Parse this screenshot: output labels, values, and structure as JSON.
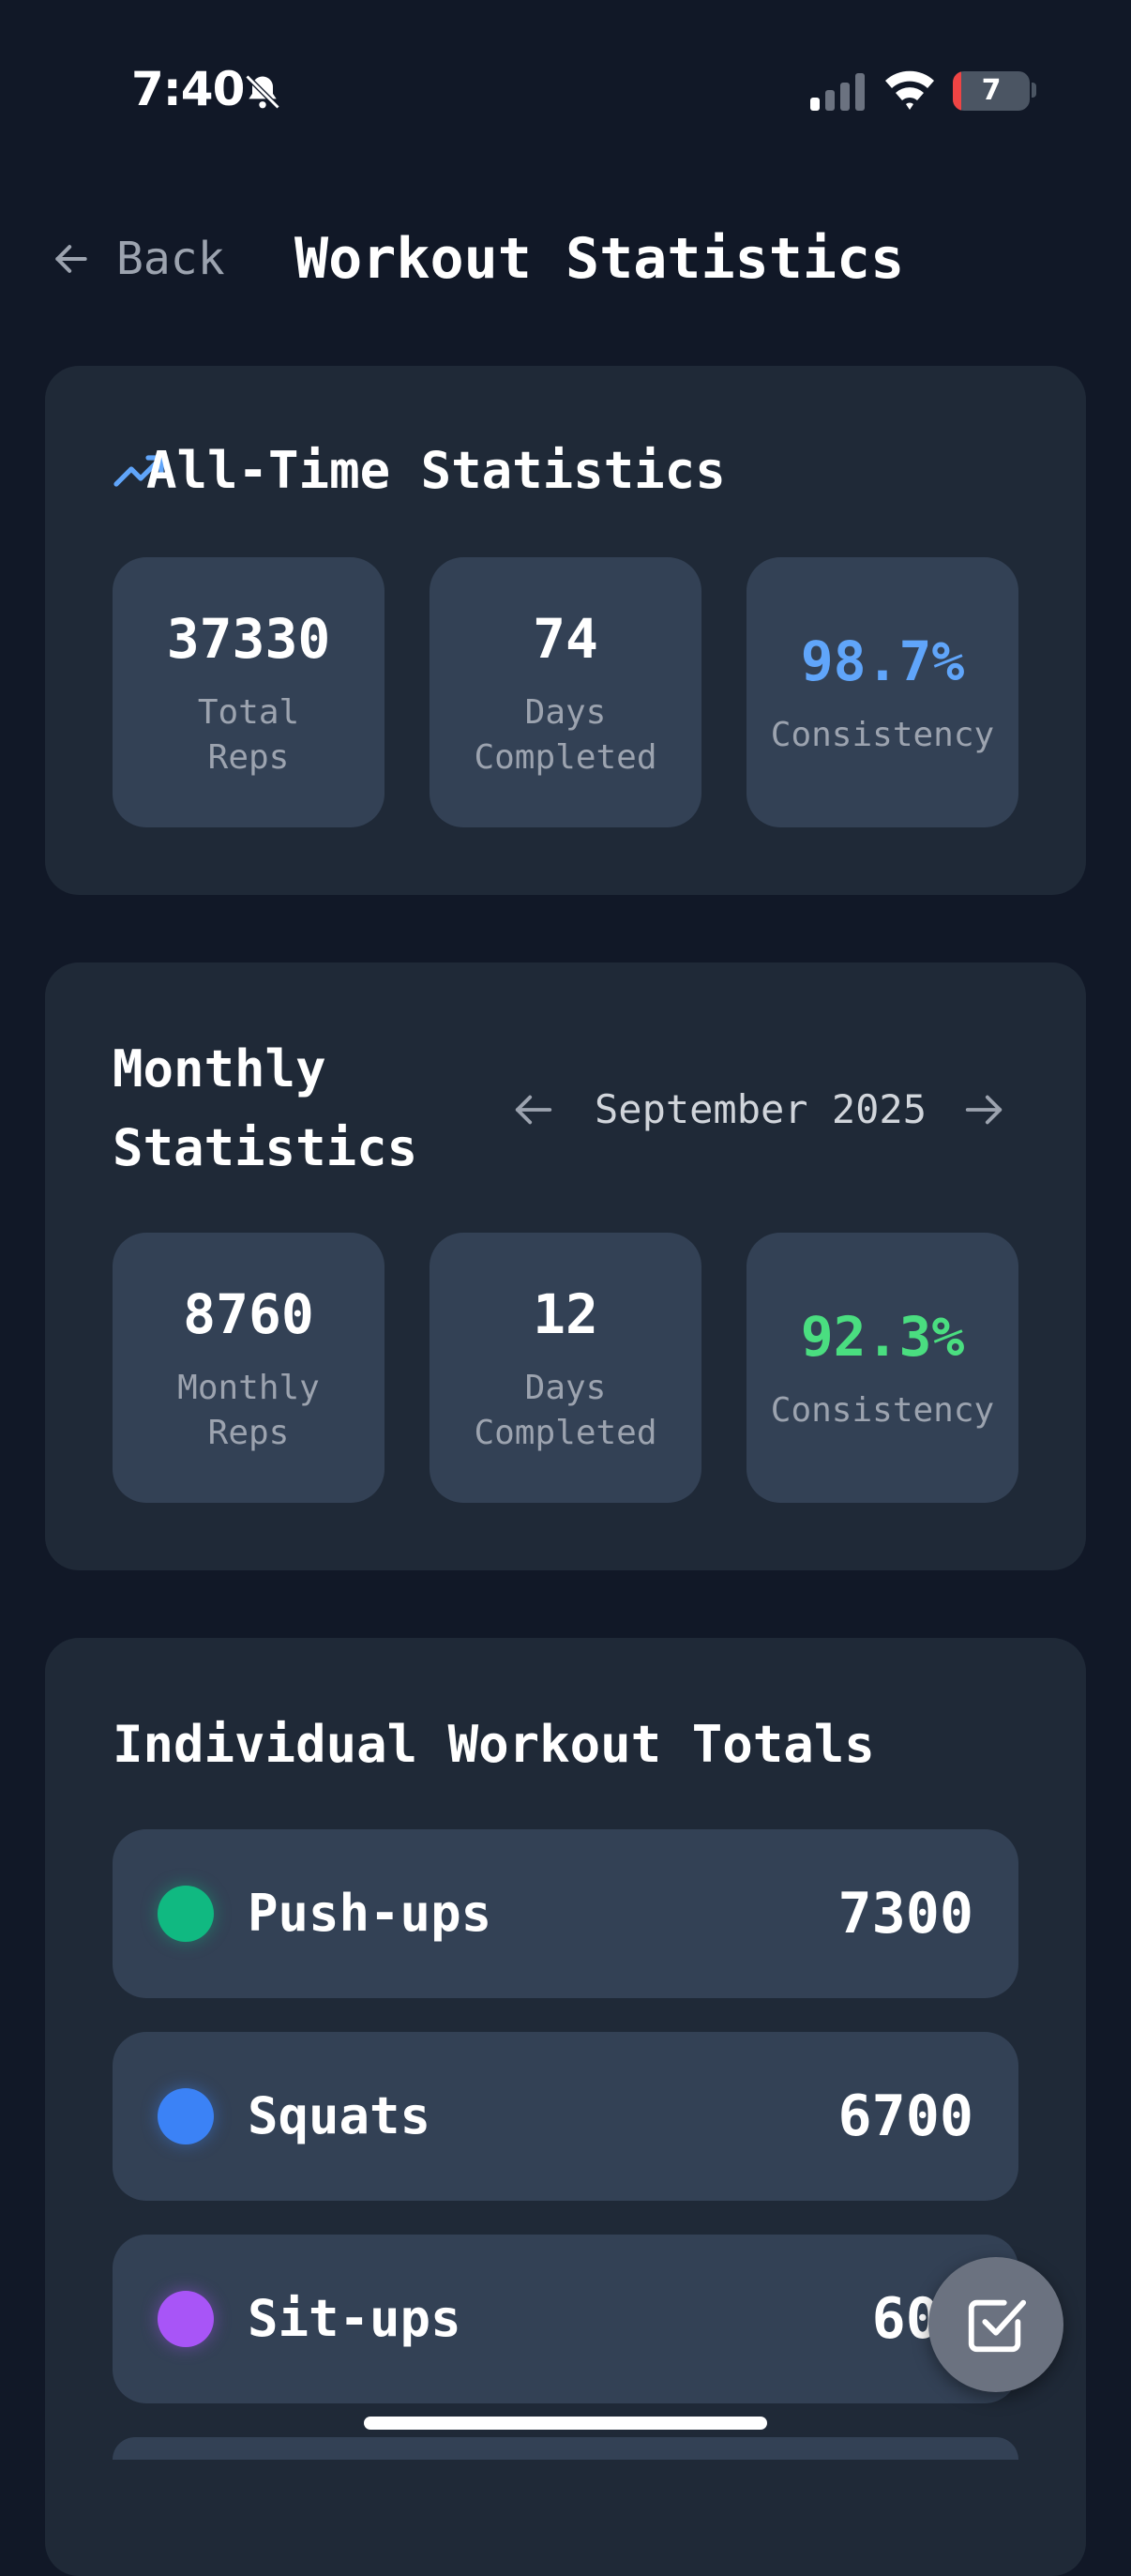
{
  "status_bar": {
    "time": "7:40",
    "battery": "7",
    "icons": [
      "bell-slash-icon",
      "signal-icon",
      "wifi-icon",
      "battery-icon"
    ]
  },
  "header": {
    "back_label": "Back",
    "title": "Workout Statistics"
  },
  "all_time": {
    "title": "All-Time Statistics",
    "icon": "trending-up-icon",
    "stats": [
      {
        "value": "37330",
        "label_lines": [
          "Total",
          "Reps"
        ],
        "color": "#ffffff"
      },
      {
        "value": "74",
        "label_lines": [
          "Days",
          "Completed"
        ],
        "color": "#ffffff"
      },
      {
        "value": "98.7%",
        "label_lines": [
          "Consistency"
        ],
        "color": "#60a5fa"
      }
    ]
  },
  "monthly": {
    "title_lines": [
      "Monthly",
      "Statistics"
    ],
    "month_label": "September 2025",
    "stats": [
      {
        "value": "8760",
        "label_lines": [
          "Monthly",
          "Reps"
        ],
        "color": "#ffffff"
      },
      {
        "value": "12",
        "label_lines": [
          "Days",
          "Completed"
        ],
        "color": "#ffffff"
      },
      {
        "value": "92.3%",
        "label_lines": [
          "Consistency"
        ],
        "color": "#4ade80"
      }
    ]
  },
  "individual": {
    "title": "Individual Workout Totals",
    "workouts": [
      {
        "name": "Push-ups",
        "total": "7300",
        "color": "#10b981"
      },
      {
        "name": "Squats",
        "total": "6700",
        "color": "#3b82f6"
      },
      {
        "name": "Sit-ups",
        "total": "600",
        "color": "#a855f7"
      }
    ]
  },
  "fab": {
    "icon": "check-square-icon"
  }
}
